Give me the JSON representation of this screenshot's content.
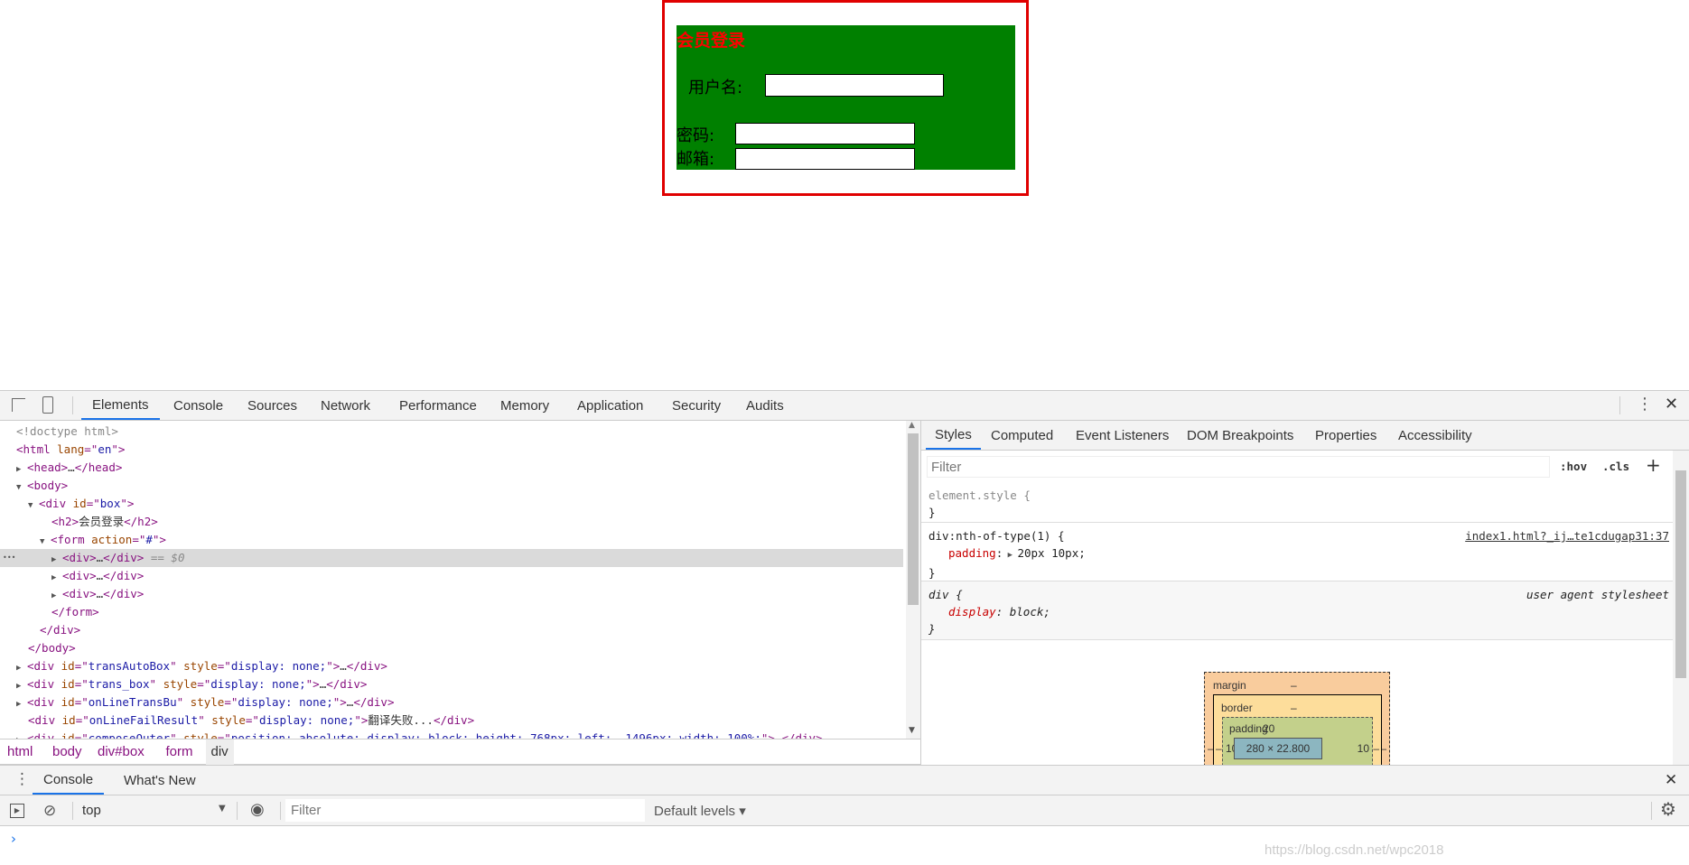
{
  "page": {
    "title": "会员登录",
    "fields": [
      {
        "label": "用户名:",
        "value": ""
      },
      {
        "label": "密码:",
        "value": ""
      },
      {
        "label": "邮箱:",
        "value": ""
      }
    ]
  },
  "devtools": {
    "tabs": [
      "Elements",
      "Console",
      "Sources",
      "Network",
      "Performance",
      "Memory",
      "Application",
      "Security",
      "Audits"
    ],
    "active_tab": "Elements",
    "dom": [
      {
        "parts": [
          [
            "gr",
            "<!doctype html>"
          ]
        ]
      },
      {
        "parts": [
          [
            "tg",
            "<html "
          ],
          [
            "at",
            "lang"
          ],
          [
            "tg",
            "=\""
          ],
          [
            "av",
            "en"
          ],
          [
            "tg",
            "\">"
          ]
        ]
      },
      {
        "tri": "▶",
        "parts": [
          [
            "tg",
            "<head>"
          ],
          [
            "",
            "…"
          ],
          [
            "tg",
            "</head>"
          ]
        ]
      },
      {
        "tri": "▼",
        "parts": [
          [
            "tg",
            "<body>"
          ]
        ]
      },
      {
        "tri": "▼",
        "parts": [
          [
            "tg",
            "<div "
          ],
          [
            "at",
            "id"
          ],
          [
            "tg",
            "=\""
          ],
          [
            "av",
            "box"
          ],
          [
            "tg",
            "\">"
          ]
        ]
      },
      {
        "parts": [
          [
            "tg",
            "<h2>"
          ],
          [
            "",
            "会员登录"
          ],
          [
            "tg",
            "</h2>"
          ]
        ]
      },
      {
        "tri": "▼",
        "parts": [
          [
            "tg",
            "<form "
          ],
          [
            "at",
            "action"
          ],
          [
            "tg",
            "=\""
          ],
          [
            "av",
            "#"
          ],
          [
            "tg",
            "\">"
          ]
        ]
      },
      {
        "tri": "▶",
        "parts": [
          [
            "tg",
            "<div>"
          ],
          [
            "",
            "…"
          ],
          [
            "tg",
            "</div>"
          ],
          [
            "gr",
            " == $0"
          ]
        ],
        "selected": true
      },
      {
        "tri": "▶",
        "parts": [
          [
            "tg",
            "<div>"
          ],
          [
            "",
            "…"
          ],
          [
            "tg",
            "</div>"
          ]
        ]
      },
      {
        "tri": "▶",
        "parts": [
          [
            "tg",
            "<div>"
          ],
          [
            "",
            "…"
          ],
          [
            "tg",
            "</div>"
          ]
        ]
      },
      {
        "parts": [
          [
            "tg",
            "</form>"
          ]
        ]
      },
      {
        "parts": [
          [
            "tg",
            "</div>"
          ]
        ]
      },
      {
        "parts": [
          [
            "tg",
            "</body>"
          ]
        ]
      },
      {
        "tri": "▶",
        "parts": [
          [
            "tg",
            "<div "
          ],
          [
            "at",
            "id"
          ],
          [
            "tg",
            "=\""
          ],
          [
            "av",
            "transAutoBox"
          ],
          [
            "tg",
            "\" "
          ],
          [
            "at",
            "style"
          ],
          [
            "tg",
            "=\""
          ],
          [
            "av",
            "display: none;"
          ],
          [
            "tg",
            "\">"
          ],
          [
            "",
            "…"
          ],
          [
            "tg",
            "</div>"
          ]
        ]
      },
      {
        "tri": "▶",
        "parts": [
          [
            "tg",
            "<div "
          ],
          [
            "at",
            "id"
          ],
          [
            "tg",
            "=\""
          ],
          [
            "av",
            "trans_box"
          ],
          [
            "tg",
            "\" "
          ],
          [
            "at",
            "style"
          ],
          [
            "tg",
            "=\""
          ],
          [
            "av",
            "display: none;"
          ],
          [
            "tg",
            "\">"
          ],
          [
            "",
            "…"
          ],
          [
            "tg",
            "</div>"
          ]
        ]
      },
      {
        "tri": "▶",
        "parts": [
          [
            "tg",
            "<div "
          ],
          [
            "at",
            "id"
          ],
          [
            "tg",
            "=\""
          ],
          [
            "av",
            "onLineTransBu"
          ],
          [
            "tg",
            "\" "
          ],
          [
            "at",
            "style"
          ],
          [
            "tg",
            "=\""
          ],
          [
            "av",
            "display: none;"
          ],
          [
            "tg",
            "\">"
          ],
          [
            "",
            "…"
          ],
          [
            "tg",
            "</div>"
          ]
        ]
      },
      {
        "parts": [
          [
            "tg",
            "<div "
          ],
          [
            "at",
            "id"
          ],
          [
            "tg",
            "=\""
          ],
          [
            "av",
            "onLineFailResult"
          ],
          [
            "tg",
            "\" "
          ],
          [
            "at",
            "style"
          ],
          [
            "tg",
            "=\""
          ],
          [
            "av",
            "display: none;"
          ],
          [
            "tg",
            "\">"
          ],
          [
            "",
            "翻译失败..."
          ],
          [
            "tg",
            "</div>"
          ]
        ]
      },
      {
        "tri": "▶",
        "parts": [
          [
            "tg",
            "<div "
          ],
          [
            "at",
            "id"
          ],
          [
            "tg",
            "=\""
          ],
          [
            "av",
            "composeOuter"
          ],
          [
            "tg",
            "\" "
          ],
          [
            "at",
            "style"
          ],
          [
            "tg",
            "=\""
          ],
          [
            "av",
            "position: absolute; display: block; height: 768px; left: -1496px; width: 100%;"
          ],
          [
            "tg",
            "\">"
          ],
          [
            "",
            "…"
          ],
          [
            "tg",
            "</div>"
          ]
        ]
      }
    ],
    "breadcrumb": [
      "html",
      "body",
      "div#box",
      "form",
      "div"
    ],
    "styles_tabs": [
      "Styles",
      "Computed",
      "Event Listeners",
      "DOM Breakpoints",
      "Properties",
      "Accessibility"
    ],
    "filter_placeholder": "Filter",
    "hov": ":hov",
    "cls": ".cls",
    "plus": "+",
    "rules": {
      "element_style": "element.style {",
      "close": "}",
      "r1_selector": "div:nth-of-type(1) {",
      "r1_source": "index1.html?_ij…te1cdugap31:37",
      "r1_prop": "padding",
      "r1_val": "20px 10px;",
      "r2_selector": "div {",
      "r2_source": "user agent stylesheet",
      "r2_prop": "display",
      "r2_val": "block;"
    },
    "box_model": {
      "margin_label": "margin",
      "margin": "–",
      "border_label": "border",
      "border": "–",
      "padding_label": "padding",
      "padding_top": "20",
      "padding_left": "10",
      "padding_right": "10",
      "content": "280 × 22.800",
      "dash": "–"
    },
    "drawer_tabs": [
      "Console",
      "What's New"
    ],
    "console": {
      "context": "top",
      "filter_placeholder": "Filter",
      "levels": "Default levels ▾",
      "prompt": "›"
    },
    "watermark": "https://blog.csdn.net/wpc2018"
  }
}
